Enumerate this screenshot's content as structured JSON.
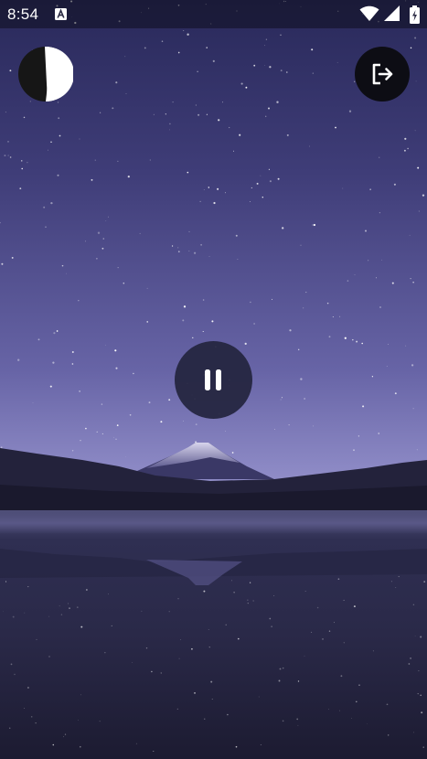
{
  "status_bar": {
    "time": "8:54",
    "notification_icon": "a-letter-icon",
    "wifi_icon": "wifi-icon",
    "signal_icon": "signal-icon",
    "battery_icon": "battery-charging-icon"
  },
  "controls": {
    "theme_toggle_icon": "contrast-icon",
    "exit_icon": "logout-icon",
    "playback_icon": "pause-icon"
  },
  "background": {
    "scene": "starry-night-mountain-lake",
    "colors": {
      "sky_top": "#2a2b56",
      "sky_horizon": "#8784c6",
      "water": "#2b2a4c",
      "button_dark": "#0d0d14"
    }
  }
}
